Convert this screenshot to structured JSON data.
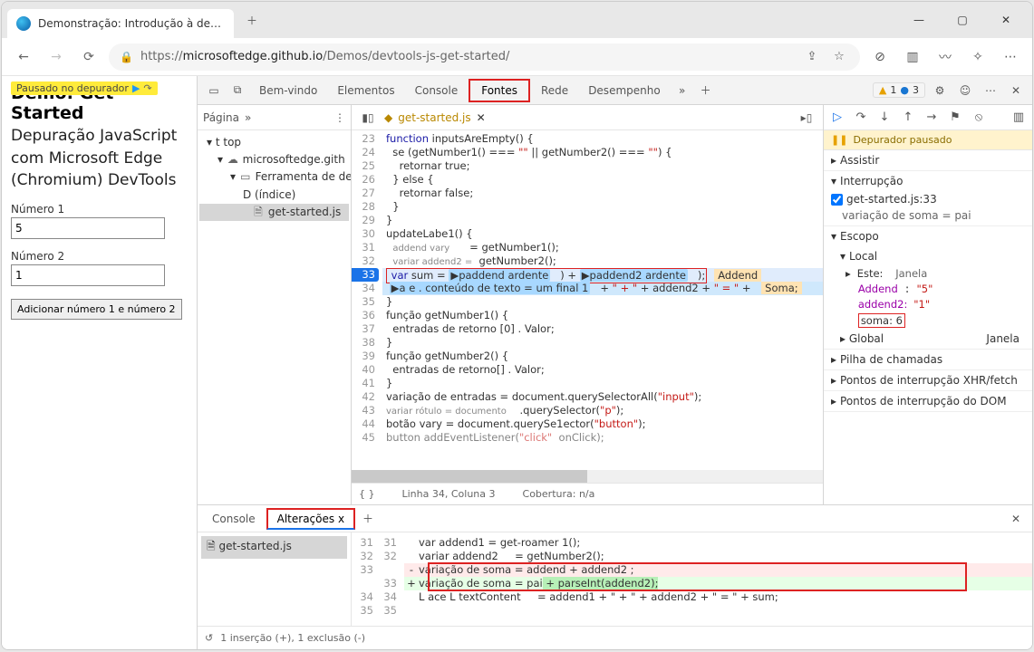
{
  "tab_title": "Demonstração: Introdução à depuração k",
  "url_prefix": "https://",
  "url_domain": "microsoftedge.github.io",
  "url_path": "/Demos/devtools-js-get-started/",
  "paused_badge": "Pausado no depurador",
  "page": {
    "h1": "Demo: Get Started",
    "sub": "Depuração JavaScript com Microsoft Edge (Chromium) DevTools",
    "label1": "Número 1",
    "val1": "5",
    "label2": "Número 2",
    "val2": "1",
    "button": "Adicionar número 1 e número 2"
  },
  "toolbar": {
    "bemvindo": "Bem-vindo",
    "elementos": "Elementos",
    "console": "Console",
    "fontes": "Fontes",
    "rede": "Rede",
    "desempenho": "Desempenho",
    "warn_count": "1",
    "info_count": "3"
  },
  "left_pane": {
    "title": "Página",
    "root": "t top",
    "domain": "microsoftedge.gith",
    "folder": "Ferramenta de desenvolvimento",
    "index": "D (índice)",
    "file": "get-started.js"
  },
  "source": {
    "filename": "get-started.js",
    "lines_start": 23,
    "lines": [
      "function inputsAreEmpty() {",
      "  se (getNumber1() === \"\" || getNumber2() === \"\") {",
      "    retornar true;",
      "  } else {",
      "    retornar false;",
      "  }",
      "}",
      "updateLabe1() {",
      "  addend vary       = getNumber1();",
      "  variar addend2 =  getNumber2();",
      "  var sum = ▶paddend ardente    ) + ▶paddend2 ardente    );",
      "  ▶a e . conteúdo de texto = um final 1   + \" + \" + addend2 + \" = \" + Soma;",
      "}",
      "função getNumber1() {",
      "  entradas de retorno [0] . Valor;",
      "}",
      "função getNumber2() {",
      "  entradas de retorno[] . Valor;",
      "}",
      "variação de entradas = document.querySelectorAll(\"input\");",
      "variar rótulo = documento    .querySelector(\"p\");",
      "botão vary = document.querySe1ector(\"button\");",
      "button addEventListener(\"click\"  onClick);"
    ],
    "status_loc": "Linha 34, Coluna 3",
    "status_cov": "Cobertura: n/a",
    "endchip33": "Addend",
    "endchip34": "Soma;"
  },
  "debugger": {
    "banner": "Depurador pausado",
    "watch": "Assistir",
    "breakpoints": "Interrupção",
    "bp_file": "get-started.js:33",
    "bp_cond": "variação de soma = pai",
    "scope": "Escopo",
    "local": "Local",
    "this_lbl": "Este:",
    "this_val": "Janela",
    "v1n": "Addend",
    "v1v": "\"5\"",
    "v2n": "addend2:",
    "v2v": "\"1\"",
    "v3": "soma: 6",
    "global": "Global",
    "global_v": "Janela",
    "callstack": "Pilha de chamadas",
    "xhr": "Pontos de interrupção XHR/fetch",
    "dom": "Pontos de interrupção do DOM"
  },
  "drawer": {
    "console": "Console",
    "changes": "Alterações x",
    "file": "get-started.js",
    "lines": {
      "a": "var addend1 = get-roamer 1();",
      "b": "variar addend2     = getNumber2();",
      "del": "variação de soma = addend + addend2 ;",
      "add_l": "variação de soma = pai",
      "add_r": " + parseInt(addend2);",
      "c": "L ace L textContent      = addend1 + \" + \" + addend2 + \" = \" + sum;",
      "d": ""
    },
    "summary": "1 inserção (+), 1 exclusão (-)"
  }
}
